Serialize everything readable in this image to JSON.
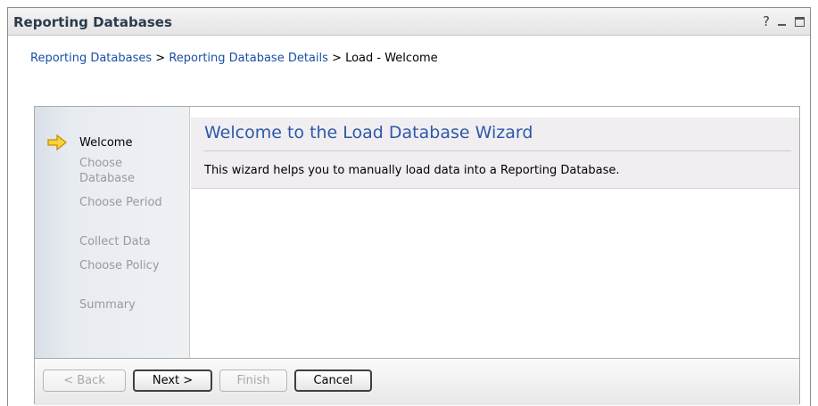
{
  "portlet": {
    "title": "Reporting Databases",
    "help_label": "?"
  },
  "breadcrumb": {
    "items": [
      "Reporting Databases",
      "Reporting Database Details"
    ],
    "separator": ">",
    "current": "Load - Welcome"
  },
  "wizard": {
    "steps": [
      {
        "label": "Welcome",
        "current": true
      },
      {
        "label": "Choose Database",
        "current": false
      },
      {
        "label": "Choose Period",
        "current": false
      },
      {
        "label": "Collect Data",
        "current": false
      },
      {
        "label": "Choose Policy",
        "current": false
      },
      {
        "label": "Summary",
        "current": false
      }
    ],
    "title": "Welcome to the Load Database Wizard",
    "description": "This wizard helps you to manually load data into a Reporting Database.",
    "buttons": {
      "back": "< Back",
      "next": "Next >",
      "finish": "Finish",
      "cancel": "Cancel"
    }
  },
  "colors": {
    "link": "#1a4fa6",
    "wizard_title": "#2c5aa6",
    "current_step_arrow": "#f2b800"
  }
}
